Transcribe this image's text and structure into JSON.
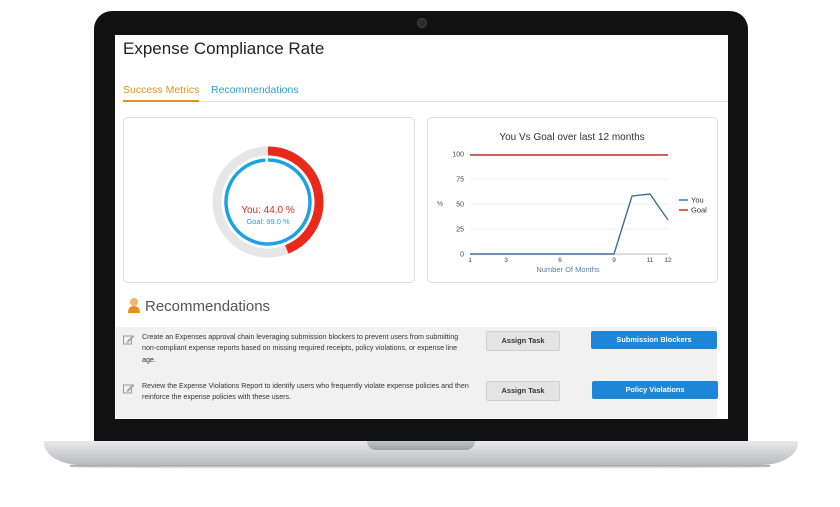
{
  "page": {
    "title": "Expense Compliance Rate"
  },
  "tabs": [
    {
      "label": "Success Metrics",
      "active": true
    },
    {
      "label": "Recommendations",
      "active": false
    }
  ],
  "compliance_donut": {
    "you_label": "You: 44.0 %",
    "goal_label": "Goal: 99.0 %",
    "you_value": 44.0,
    "goal_value": 99.0,
    "you_color": "#e8291c",
    "goal_color": "#1ea1e2"
  },
  "chart_data": {
    "type": "line",
    "title": "You Vs Goal over last 12 months",
    "xlabel": "Number Of Months",
    "ylabel": "%",
    "x": [
      1,
      2,
      3,
      4,
      5,
      6,
      7,
      8,
      9,
      10,
      11,
      12
    ],
    "x_ticks": [
      1,
      3,
      6,
      9,
      11,
      12
    ],
    "y_ticks": [
      0,
      25,
      50,
      75,
      100
    ],
    "ylim": [
      0,
      100
    ],
    "legend_position": "right",
    "series": [
      {
        "name": "You",
        "color": "#3d6e9c",
        "values": [
          0,
          0,
          0,
          0,
          0,
          0,
          0,
          0,
          0,
          58,
          60,
          34
        ]
      },
      {
        "name": "Goal",
        "color": "#c0302a",
        "values": [
          99,
          99,
          99,
          99,
          99,
          99,
          99,
          99,
          99,
          99,
          99,
          99
        ]
      }
    ]
  },
  "recommendations": {
    "title": "Recommendations",
    "items": [
      {
        "text": "Create an Expenses approval chain leveraging submission blockers to prevent users from submitting non-compliant expense reports based on missing required receipts, policy violations, or expense line age.",
        "assign_label": "Assign Task",
        "action_label": "Submission Blockers"
      },
      {
        "text": "Review the Expense Violations Report to identify users who frequently violate expense policies and then reinforce the expense policies with these users.",
        "assign_label": "Assign Task",
        "action_label": "Policy Violations"
      }
    ]
  },
  "colors": {
    "accent_orange": "#e8901c",
    "link_blue": "#2a9fd6",
    "button_blue": "#1d86d6"
  }
}
